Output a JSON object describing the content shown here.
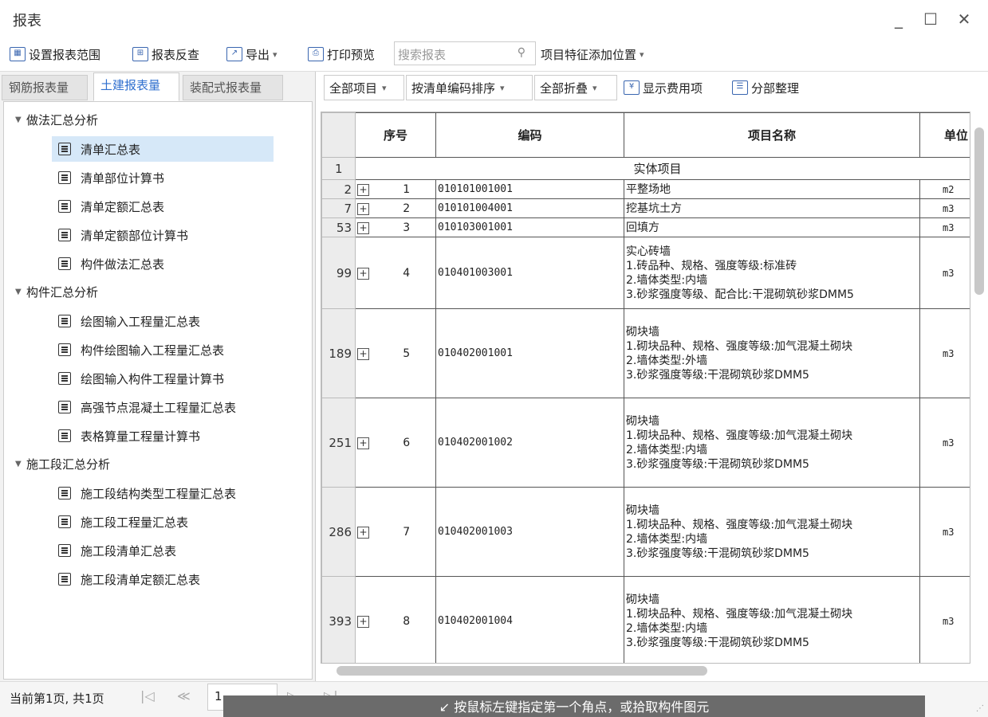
{
  "window": {
    "title": "报表",
    "minimize": "_",
    "maximize": "☐",
    "close": "✕"
  },
  "toolbar": {
    "set_range": "设置报表范围",
    "reverse_check": "报表反查",
    "export": "导出",
    "print_preview": "打印预览",
    "search_placeholder": "搜索报表",
    "feature_position": "项目特征添加位置"
  },
  "left_tabs": [
    "钢筋报表量",
    "土建报表量",
    "装配式报表量"
  ],
  "tree": {
    "groups": [
      {
        "label": "做法汇总分析",
        "items": [
          "清单汇总表",
          "清单部位计算书",
          "清单定额汇总表",
          "清单定额部位计算书",
          "构件做法汇总表"
        ]
      },
      {
        "label": "构件汇总分析",
        "items": [
          "绘图输入工程量汇总表",
          "构件绘图输入工程量汇总表",
          "绘图输入构件工程量计算书",
          "高强节点混凝土工程量汇总表",
          "表格算量工程量计算书"
        ]
      },
      {
        "label": "施工段汇总分析",
        "items": [
          "施工段结构类型工程量汇总表",
          "施工段工程量汇总表",
          "施工段清单汇总表",
          "施工段清单定额汇总表"
        ]
      }
    ],
    "selected": "清单汇总表"
  },
  "right_toolbar": {
    "all_items": "全部项目",
    "sort_by": "按清单编码排序",
    "collapse": "全部折叠",
    "show_fee": "显示费用项",
    "reorganize": "分部整理"
  },
  "table": {
    "headers": {
      "seq": "序号",
      "code": "编码",
      "name": "项目名称",
      "unit": "单位"
    },
    "section_row": {
      "rn": "1",
      "label": "实体项目"
    },
    "rows": [
      {
        "rn": "2",
        "seq": "1",
        "code": "010101001001",
        "name": "平整场地",
        "unit": "m2"
      },
      {
        "rn": "7",
        "seq": "2",
        "code": "010101004001",
        "name": "挖基坑土方",
        "unit": "m3"
      },
      {
        "rn": "53",
        "seq": "3",
        "code": "010103001001",
        "name": "回填方",
        "unit": "m3"
      },
      {
        "rn": "99",
        "seq": "4",
        "code": "010401003001",
        "name": "实心砖墙\n1.砖品种、规格、强度等级:标准砖\n2.墙体类型:内墙\n3.砂浆强度等级、配合比:干混砌筑砂浆DMM5",
        "unit": "m3"
      },
      {
        "rn": "189",
        "seq": "5",
        "code": "010402001001",
        "name": "砌块墙\n1.砌块品种、规格、强度等级:加气混凝土砌块\n2.墙体类型:外墙\n3.砂浆强度等级:干混砌筑砂浆DMM5",
        "unit": "m3"
      },
      {
        "rn": "251",
        "seq": "6",
        "code": "010402001002",
        "name": "砌块墙\n1.砌块品种、规格、强度等级:加气混凝土砌块\n2.墙体类型:内墙\n3.砂浆强度等级:干混砌筑砂浆DMM5",
        "unit": "m3"
      },
      {
        "rn": "286",
        "seq": "7",
        "code": "010402001003",
        "name": "砌块墙\n1.砌块品种、规格、强度等级:加气混凝土砌块\n2.墙体类型:内墙\n3.砂浆强度等级:干混砌筑砂浆DMM5",
        "unit": "m3"
      },
      {
        "rn": "393",
        "seq": "8",
        "code": "010402001004",
        "name": "砌块墙\n1.砌块品种、规格、强度等级:加气混凝土砌块\n2.墙体类型:内墙\n3.砂浆强度等级:干混砌筑砂浆DMM5",
        "unit": "m3"
      }
    ]
  },
  "status": {
    "page_info": "当前第1页, 共1页",
    "page_value": "1",
    "hint": "按鼠标左键指定第一个角点，或拾取构件图元"
  }
}
